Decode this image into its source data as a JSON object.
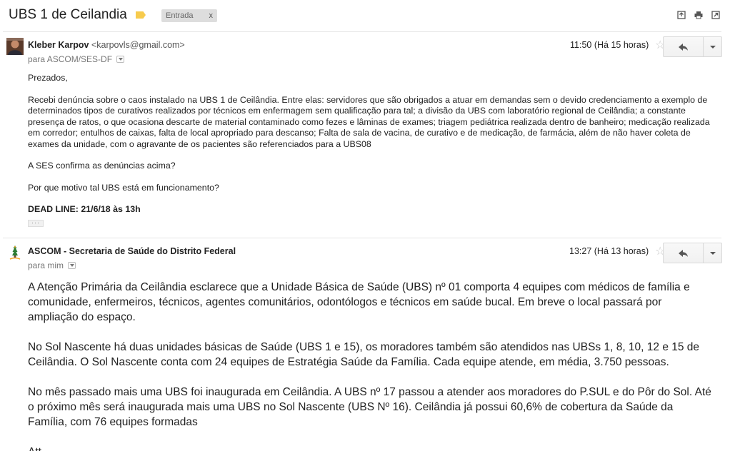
{
  "thread": {
    "subject": "UBS 1 de Ceilandia",
    "label_chip": "Entrada",
    "label_chip_close": "x",
    "label_color": "#f7cb4d"
  },
  "message1": {
    "sender_name": "Kleber Karpov",
    "sender_email": "<karpovls@gmail.com>",
    "recipient": "para ASCOM/SES-DF",
    "time": "11:50 (Há 15 horas)",
    "greeting": "Prezados,",
    "paragraph1": "Recebi denúncia sobre o caos instalado na UBS 1 de Ceilândia. Entre elas: servidores que são obrigados a atuar em demandas sem o devido credenciamento a exemplo de determinados tipos de curativos realizados por técnicos em enfermagem sem qualificação para tal; a divisão da UBS com laboratório regional de Ceilândia; a constante presença de ratos, o que ocasiona descarte de material contaminado como fezes e lâminas de exames; triagem pediátrica realizada dentro de banheiro; medicação realizada em corredor; entulhos de caixas, falta de local apropriado para descanso; Falta de  sala de vacina, de curativo e  de medicação, de farmácia, além de não haver coleta de exames da unidade, com o agravante de os pacientes são referenciados para a UBS08",
    "question1": "A SES confirma as denúncias acima?",
    "question2": "Por que motivo tal UBS está em funcionamento?",
    "deadline": "DEAD LINE:  21/6/18 às 13h",
    "ellipsis": "···"
  },
  "message2": {
    "sender_name": "ASCOM - Secretaria de Saúde do Distrito Federal",
    "recipient": "para mim",
    "time": "13:27 (Há 13 horas)",
    "paragraph1": "A Atenção Primária da Ceilândia esclarece que a Unidade Básica de Saúde (UBS) nº 01 comporta 4 equipes com médicos de família e comunidade, enfermeiros, técnicos, agentes comunitários, odontólogos e técnicos em saúde bucal. Em breve o local passará por ampliação do espaço.",
    "paragraph2": "No Sol Nascente há duas unidades básicas de Saúde (UBS 1 e 15), os moradores também são atendidos nas UBSs 1, 8, 10, 12 e 15 de Ceilândia. O Sol Nascente conta com 24 equipes de Estratégia Saúde da Família. Cada equipe atende, em média, 3.750 pessoas.",
    "paragraph3": "No mês passado mais uma UBS foi inaugurada em Ceilândia. A UBS nº 17 passou a atender aos moradores do P.SUL e do Pôr do Sol. Até o próximo mês será inaugurada mais uma UBS no Sol Nascente (UBS Nº 16).  Ceilândia já possui 60,6% de cobertura da Saúde da Família, com 76 equipes formadas",
    "closing": "Att,"
  },
  "icons": {
    "label": "label-tag-icon",
    "archive": "archive-icon",
    "print": "print-icon",
    "new_window": "new-window-icon",
    "star": "star-icon",
    "reply": "reply-icon",
    "more": "chevron-down-icon"
  }
}
